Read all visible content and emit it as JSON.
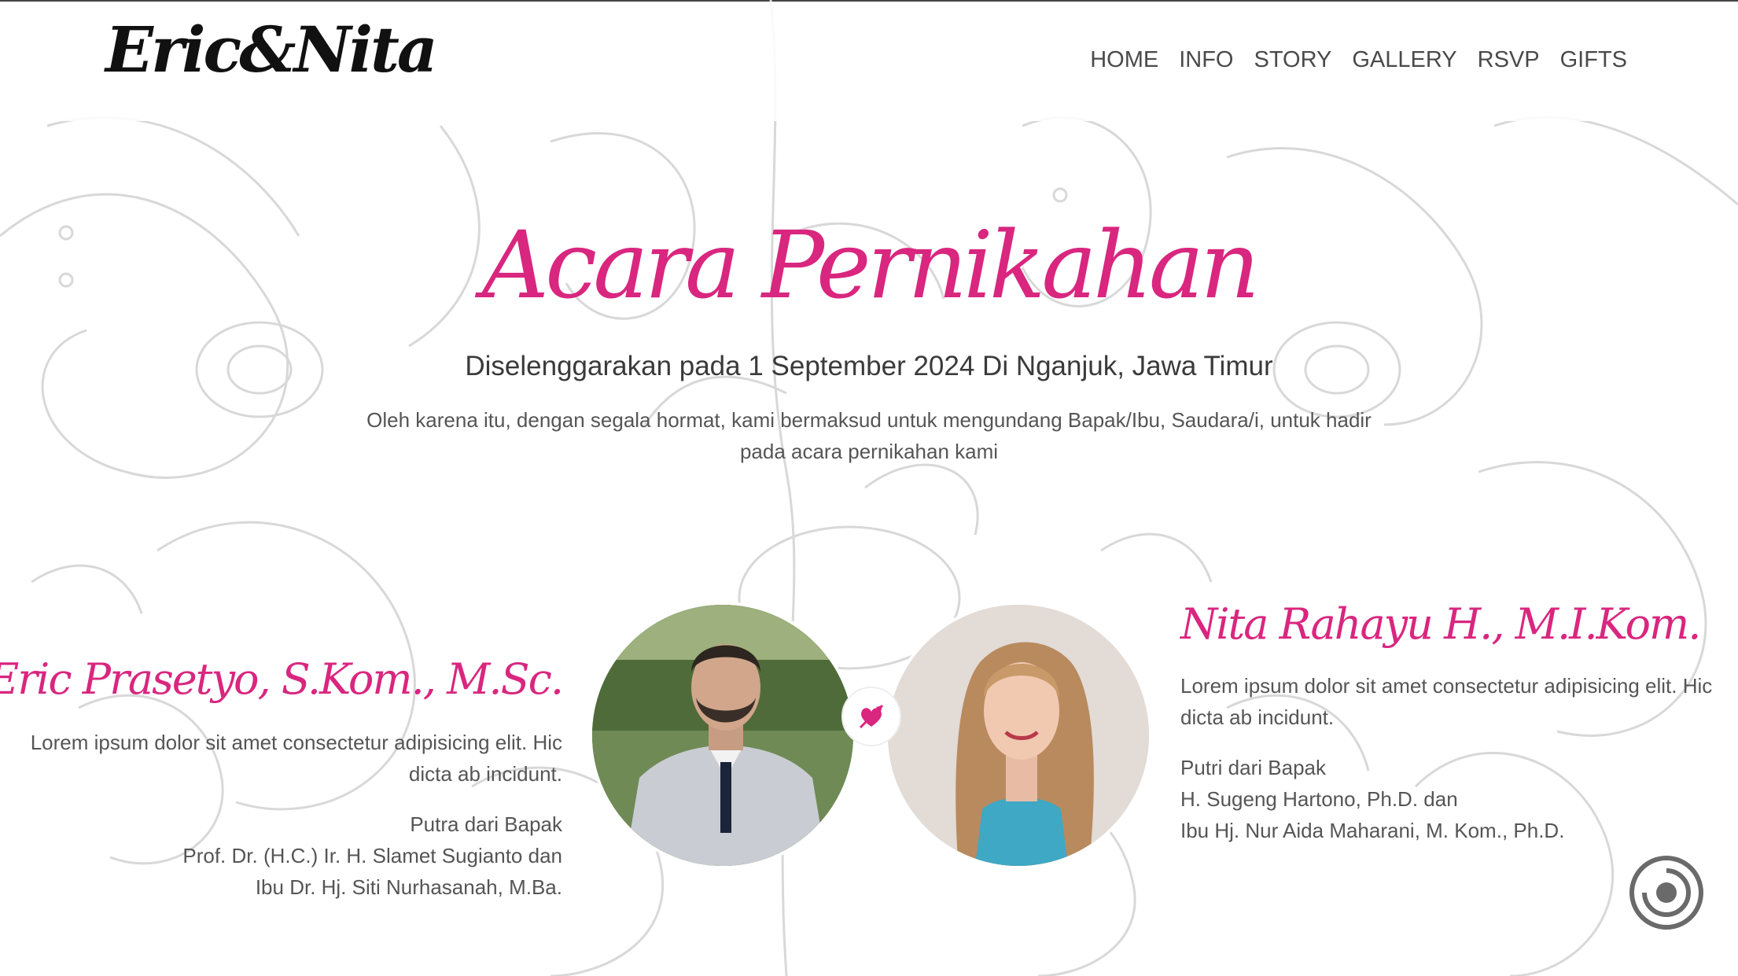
{
  "header": {
    "logo": "Eric&Nita",
    "nav": [
      "HOME",
      "INFO",
      "STORY",
      "GALLERY",
      "RSVP",
      "GIFTS"
    ]
  },
  "event": {
    "title": "Acara Pernikahan",
    "date_line": "Diselenggarakan pada 1 September 2024 Di Nganjuk, Jawa Timur",
    "invitation": "Oleh karena itu, dengan segala hormat, kami bermaksud untuk mengundang Bapak/Ibu, Saudara/i, untuk hadir pada acara pernikahan kami"
  },
  "groom": {
    "name": "Eric Prasetyo, S.Kom., M.Sc.",
    "description": "Lorem ipsum dolor sit amet consectetur adipisicing elit. Hic dicta ab incidunt.",
    "parents_label": "Putra dari Bapak",
    "father": "Prof. Dr. (H.C.) Ir. H. Slamet Sugianto dan",
    "mother": "Ibu Dr. Hj. Siti Nurhasanah, M.Ba."
  },
  "bride": {
    "name": "Nita Rahayu H., M.I.Kom.",
    "description": "Lorem ipsum dolor sit amet consectetur adipisicing elit. Hic dicta ab incidunt.",
    "parents_label": "Putri dari Bapak",
    "father": "H. Sugeng Hartono, Ph.D. dan",
    "mother": "Ibu Hj. Nur Aida Maharani, M. Kom., Ph.D."
  },
  "icons": {
    "heart_badge": "heart-arrow-icon",
    "music_button": "music-disc-icon"
  },
  "colors": {
    "accent": "#d9267f",
    "nav_text": "#4a4a4a",
    "body_text": "#555555",
    "floral_lines": "#d6d6d6"
  }
}
